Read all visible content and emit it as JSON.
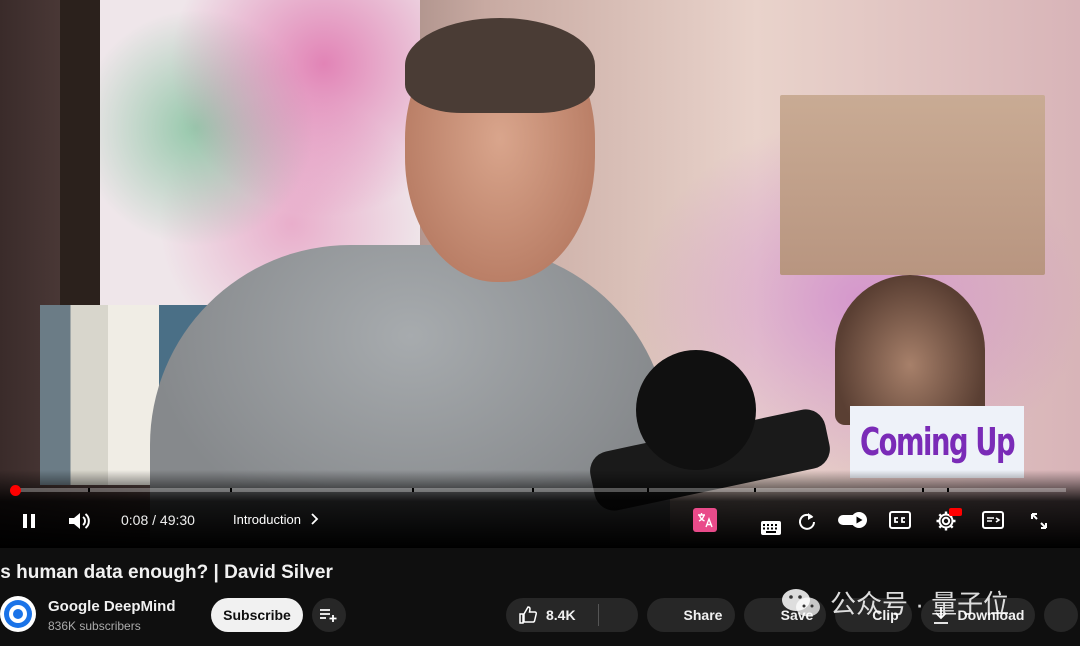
{
  "overlay": {
    "coming_up": "Coming Up"
  },
  "player": {
    "progress_fraction": 0.003,
    "time_current": "0:08",
    "time_separator": "/",
    "time_total": "49:30",
    "chapter": "Introduction",
    "accent_color": "#ff0000"
  },
  "video": {
    "title": "Is human data enough? | David Silver",
    "channel": "Google DeepMind",
    "subscribers": "836K subscribers"
  },
  "actions": {
    "subscribe": "Subscribe",
    "likes": "8.4K",
    "share": "Share",
    "save": "Save",
    "clip": "Clip",
    "download": "Download"
  },
  "watermark": {
    "text": "公众号 · 量子位"
  }
}
